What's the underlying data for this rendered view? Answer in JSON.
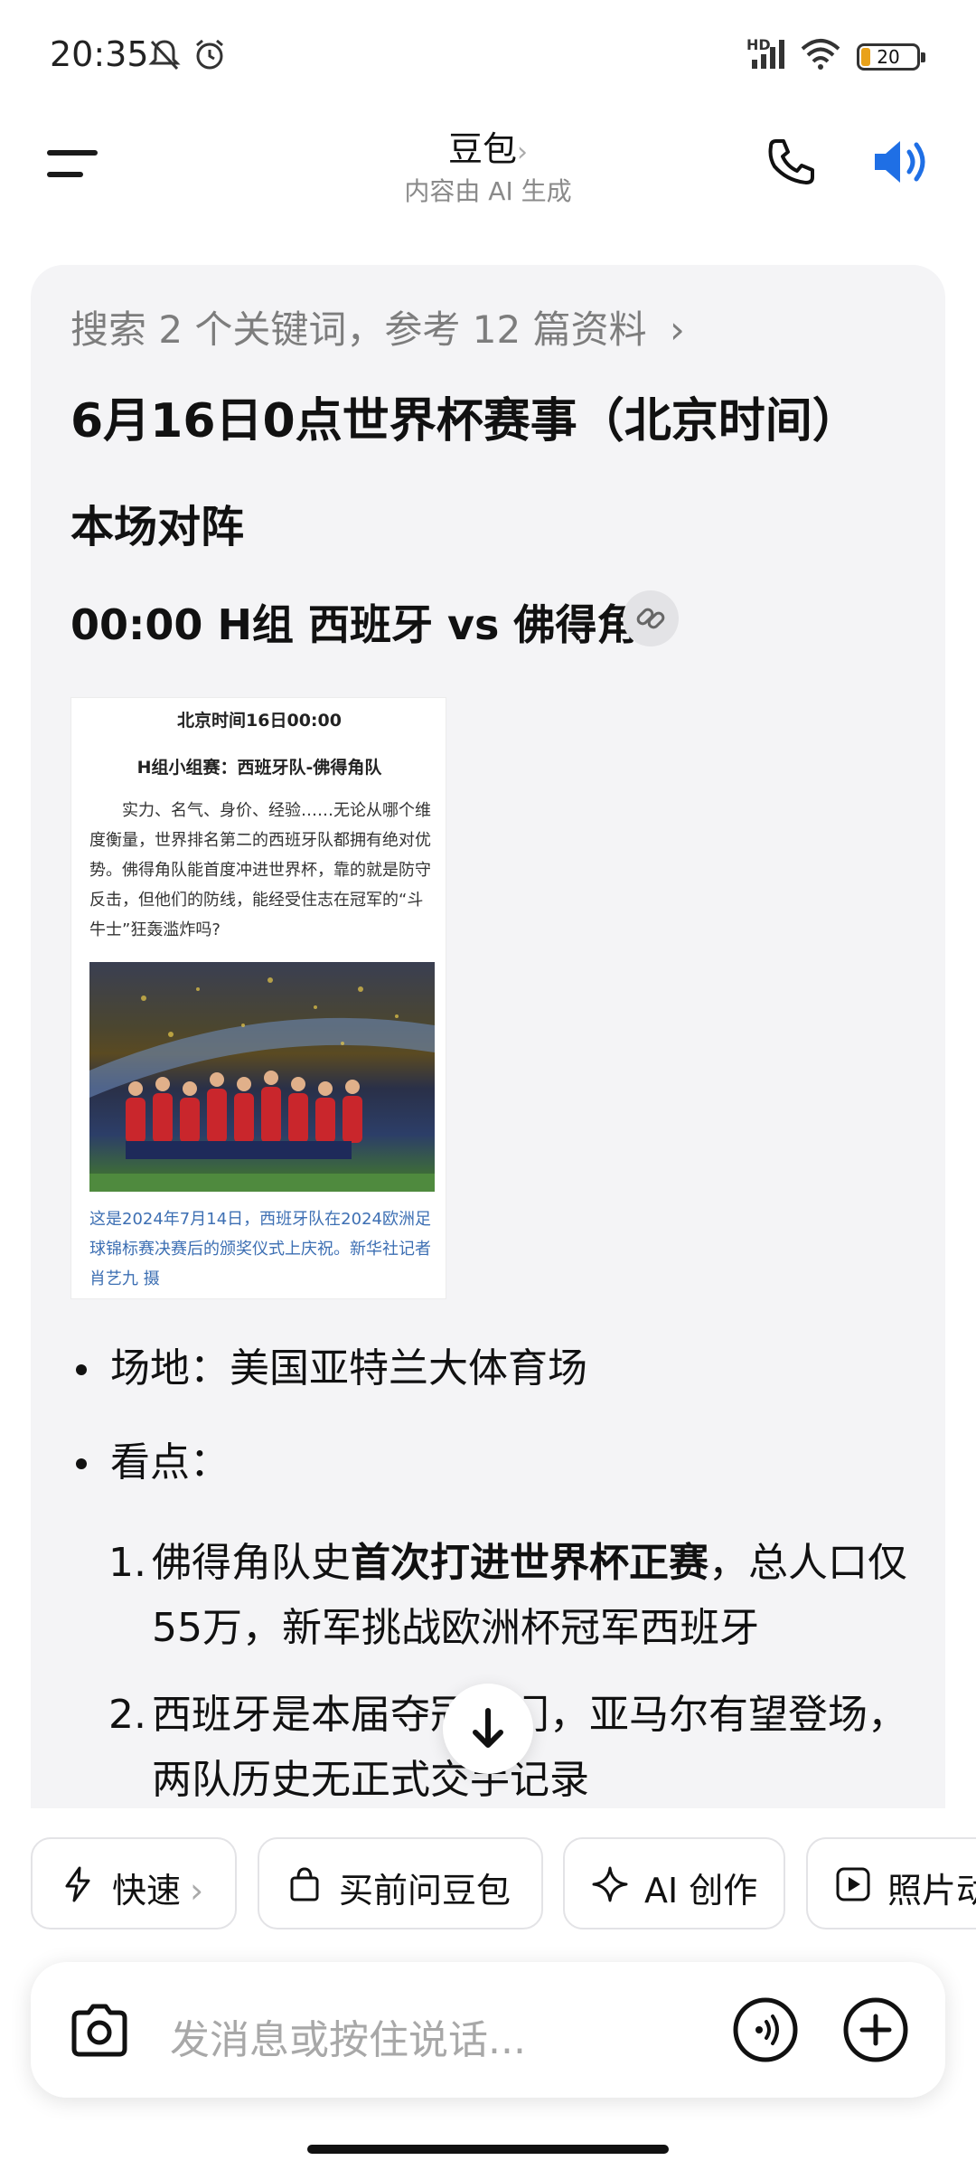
{
  "status_bar": {
    "time": "20:35",
    "network": "HD",
    "battery": "20"
  },
  "header": {
    "title": "豆包",
    "title_chevron": "›",
    "subtitle": "内容由 AI 生成"
  },
  "message": {
    "search_ref": "搜索 2 个关键词，参考 12 篇资料",
    "search_chevron": "›",
    "heading": "6月16日0点世界杯赛事（北京时间）",
    "section_title": "本场对阵",
    "match_line": "00:00 H组 西班牙 vs 佛得角",
    "news_image": {
      "title": "北京时间16日00:00",
      "subtitle": "H组小组赛：西班牙队-佛得角队",
      "body": "实力、名气、身价、经验……无论从哪个维度衡量，世界排名第二的西班牙队都拥有绝对优势。佛得角队能首度冲进世界杯，靠的就是防守反击，但他们的防线，能经受住志在冠军的“斗牛士”狂轰滥炸吗?",
      "caption": "这是2024年7月14日，西班牙队在2024欧洲足球锦标赛决赛后的颁奖仪式上庆祝。新华社记者 肖艺九 摄"
    },
    "bullets": [
      {
        "label": "场地：美国亚特兰大体育场"
      },
      {
        "label": "看点："
      }
    ],
    "points": [
      {
        "num": "1.",
        "pre": "佛得角队史",
        "bold": "首次打进世界杯正赛",
        "post": "，总人口仅55万，新军挑战欧洲杯冠军西班牙"
      },
      {
        "num": "2.",
        "pre": "西班牙是本届夺冠热门，亚马尔有望登场，两队历史无正式交手记录",
        "bold": "",
        "post": ""
      }
    ]
  },
  "chips": [
    {
      "label": "快速",
      "suffix": "›",
      "icon": "lightning-icon"
    },
    {
      "label": "买前问豆包",
      "icon": "shopping-bag-icon"
    },
    {
      "label": "AI 创作",
      "icon": "sparkle-icon"
    },
    {
      "label": "照片动",
      "icon": "play-icon"
    }
  ],
  "input": {
    "placeholder": "发消息或按住说话..."
  },
  "colors": {
    "accent": "#1f6fe5",
    "card_bg": "#f4f4f6",
    "muted_text": "#7d7d7d"
  }
}
